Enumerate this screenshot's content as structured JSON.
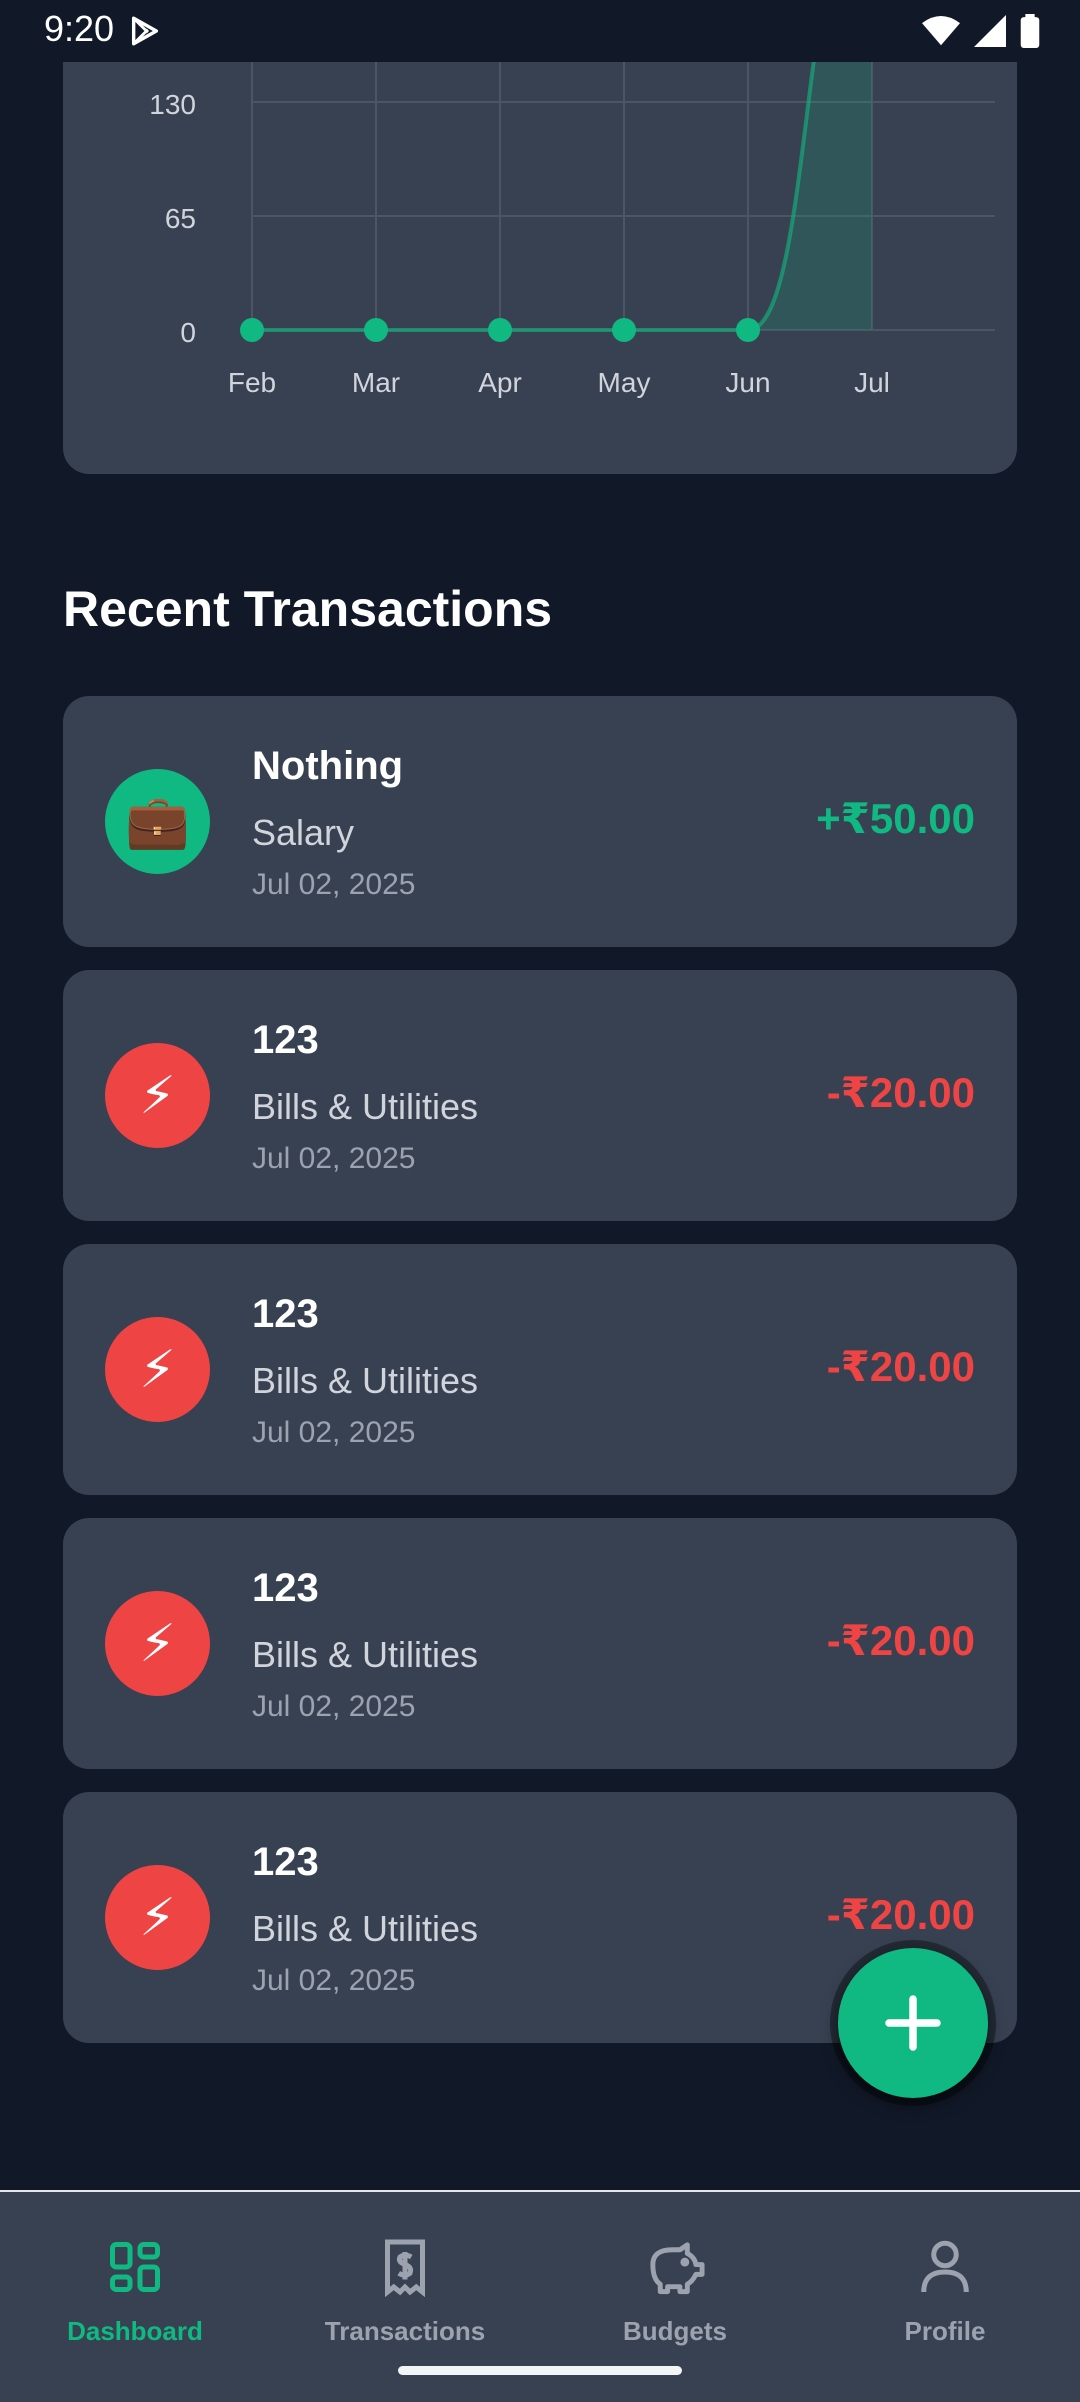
{
  "status_bar": {
    "time": "9:20"
  },
  "chart_data": {
    "type": "area",
    "x": [
      "Feb",
      "Mar",
      "Apr",
      "May",
      "Jun",
      "Jul"
    ],
    "values": [
      0,
      0,
      0,
      0,
      0,
      200
    ],
    "yticks": [
      0,
      65,
      130
    ],
    "ylim": [
      0,
      150
    ],
    "grid": true,
    "colors": {
      "line": "#10b981",
      "grid": "#4b5563"
    }
  },
  "recent": {
    "title": "Recent Transactions",
    "items": [
      {
        "name": "Nothing",
        "category": "Salary",
        "date": "Jul 02, 2025",
        "amount": "+₹50.00",
        "type": "income",
        "icon": "briefcase-icon"
      },
      {
        "name": "123",
        "category": "Bills & Utilities",
        "date": "Jul 02, 2025",
        "amount": "-₹20.00",
        "type": "expense",
        "icon": "lightning-icon"
      },
      {
        "name": "123",
        "category": "Bills & Utilities",
        "date": "Jul 02, 2025",
        "amount": "-₹20.00",
        "type": "expense",
        "icon": "lightning-icon"
      },
      {
        "name": "123",
        "category": "Bills & Utilities",
        "date": "Jul 02, 2025",
        "amount": "-₹20.00",
        "type": "expense",
        "icon": "lightning-icon"
      },
      {
        "name": "123",
        "category": "Bills & Utilities",
        "date": "Jul 02, 2025",
        "amount": "-₹20.00",
        "type": "expense",
        "icon": "lightning-icon"
      }
    ]
  },
  "nav": {
    "items": [
      {
        "label": "Dashboard",
        "active": true,
        "icon": "dashboard-icon"
      },
      {
        "label": "Transactions",
        "active": false,
        "icon": "receipt-icon"
      },
      {
        "label": "Budgets",
        "active": false,
        "icon": "piggy-bank-icon"
      },
      {
        "label": "Profile",
        "active": false,
        "icon": "user-icon"
      }
    ]
  },
  "colors": {
    "accent": "#10b981",
    "expense": "#ef4444",
    "card": "#374151",
    "background": "#111827",
    "nav_inactive": "#9ca3af"
  }
}
